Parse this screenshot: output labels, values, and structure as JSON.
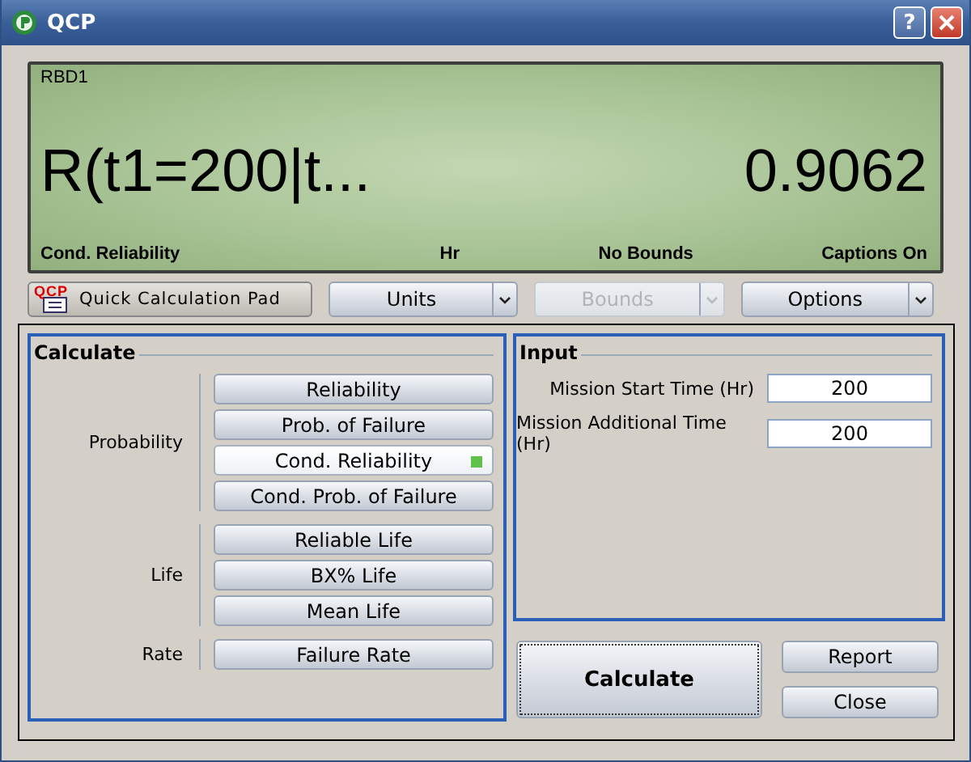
{
  "window": {
    "title": "QCP",
    "help": "?"
  },
  "display": {
    "name": "RBD1",
    "expression": "R(t1=200|t...",
    "value": "0.9062",
    "captions": [
      "Cond. Reliability",
      "Hr",
      "No Bounds",
      "Captions On"
    ]
  },
  "toolbar": {
    "pad_icon_label": "QCP",
    "pad_label": "Quick Calculation Pad",
    "dropdowns": [
      {
        "label": "Units",
        "disabled": false
      },
      {
        "label": "Bounds",
        "disabled": true
      },
      {
        "label": "Options",
        "disabled": false
      }
    ]
  },
  "calculate": {
    "title": "Calculate",
    "groups": [
      {
        "label": "Probability",
        "buttons": [
          {
            "label": "Reliability",
            "selected": false
          },
          {
            "label": "Prob. of Failure",
            "selected": false
          },
          {
            "label": "Cond. Reliability",
            "selected": true
          },
          {
            "label": "Cond. Prob. of Failure",
            "selected": false
          }
        ]
      },
      {
        "label": "Life",
        "buttons": [
          {
            "label": "Reliable Life",
            "selected": false
          },
          {
            "label": "BX% Life",
            "selected": false
          },
          {
            "label": "Mean Life",
            "selected": false
          }
        ]
      },
      {
        "label": "Rate",
        "buttons": [
          {
            "label": "Failure Rate",
            "selected": false
          }
        ]
      }
    ]
  },
  "input": {
    "title": "Input",
    "fields": [
      {
        "label": "Mission Start Time (Hr)",
        "value": "200"
      },
      {
        "label": "Mission Additional Time (Hr)",
        "value": "200"
      }
    ]
  },
  "actions": {
    "calculate": "Calculate",
    "report": "Report",
    "close": "Close"
  }
}
